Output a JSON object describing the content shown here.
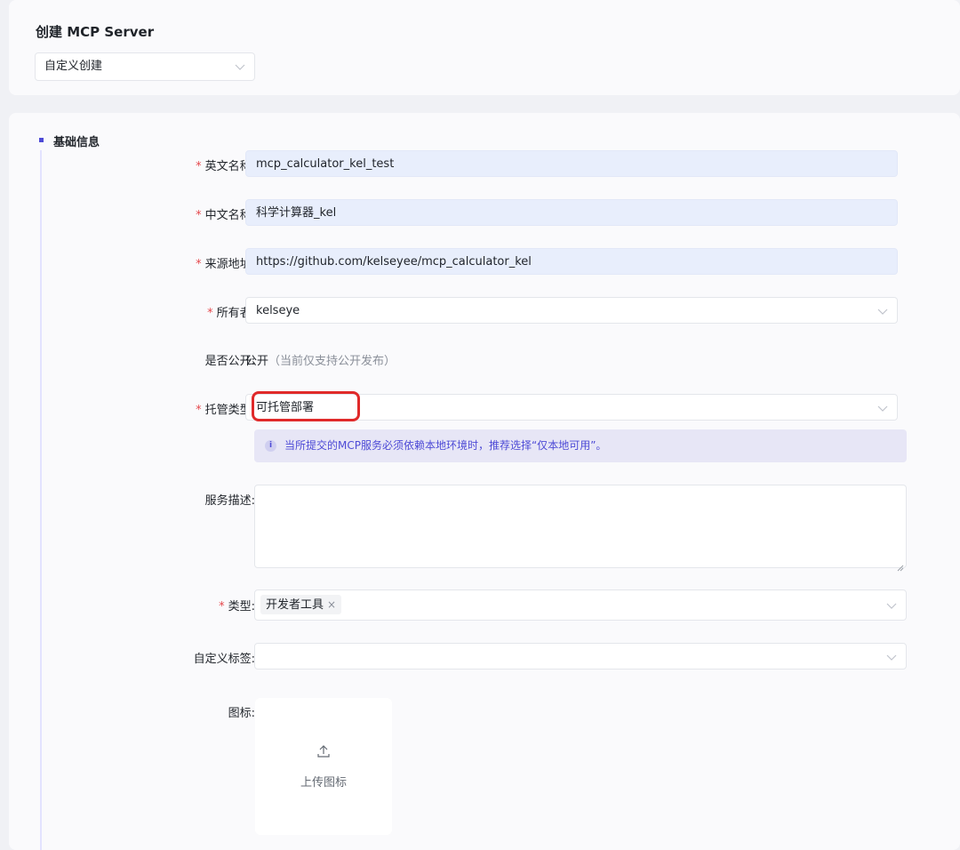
{
  "header": {
    "title": "创建 MCP Server",
    "mode_select": "自定义创建"
  },
  "section": {
    "title": "基础信息"
  },
  "form": {
    "english_name": {
      "label": "英文名称:",
      "value": "mcp_calculator_kel_test"
    },
    "chinese_name": {
      "label": "中文名称:",
      "value": "科学计算器_kel"
    },
    "source_url": {
      "label": "来源地址:",
      "value": "https://github.com/kelseyee/mcp_calculator_kel"
    },
    "owner": {
      "label": "所有者:",
      "value": "kelseye"
    },
    "public": {
      "label": "是否公开:",
      "value": "公开",
      "note": "（当前仅支持公开发布）"
    },
    "hosting_type": {
      "label": "托管类型:",
      "value": "可托管部署",
      "hint": "当所提交的MCP服务必须依赖本地环境时，推荐选择“仅本地可用”。",
      "hint_icon": "info-icon"
    },
    "description": {
      "label": "服务描述:",
      "value": ""
    },
    "category": {
      "label": "类型:",
      "tags": [
        "开发者工具"
      ]
    },
    "custom_tags": {
      "label": "自定义标签:",
      "value": ""
    },
    "icon": {
      "label": "图标:",
      "upload_label": "上传图标"
    }
  },
  "required_mark": "*",
  "colors": {
    "accent": "#4e4bd6",
    "highlight": "#e02a2a",
    "required": "#e5484d"
  }
}
